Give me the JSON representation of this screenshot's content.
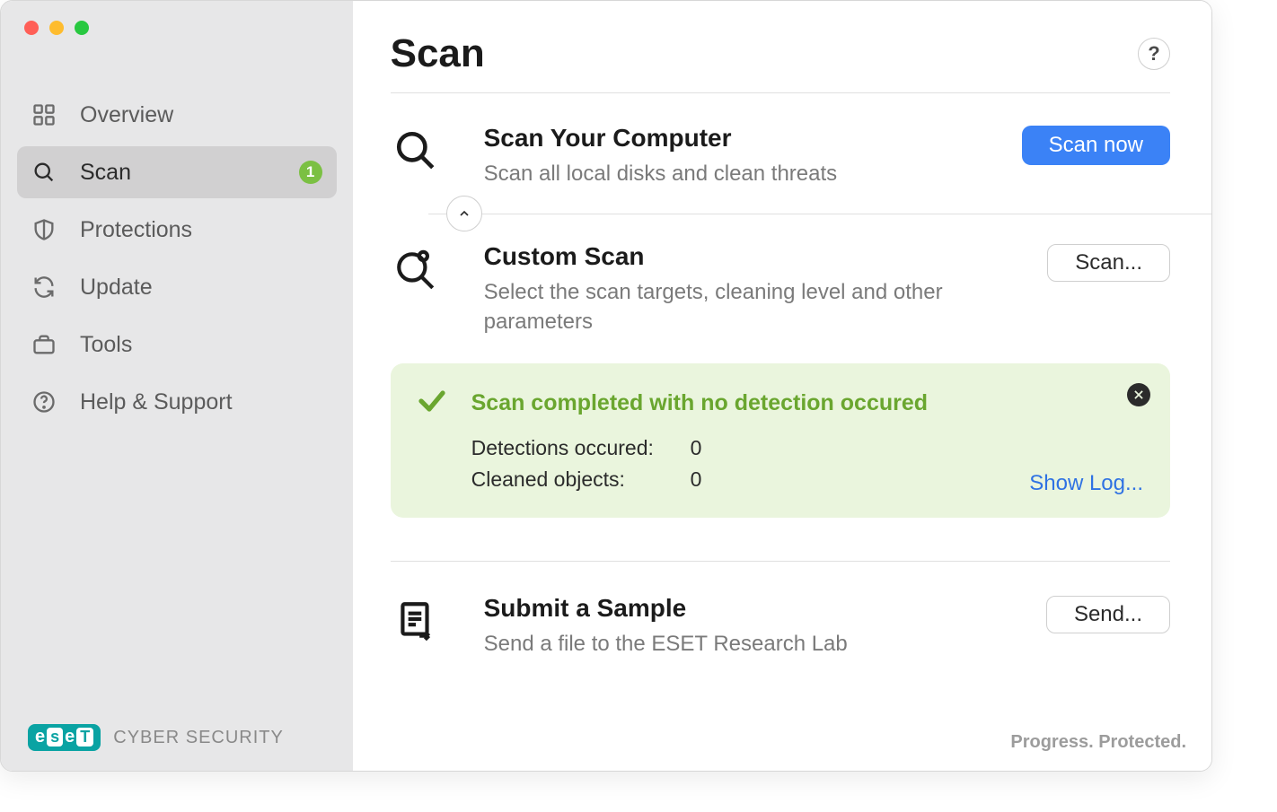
{
  "sidebar": {
    "items": [
      {
        "label": "Overview"
      },
      {
        "label": "Scan",
        "badge": "1"
      },
      {
        "label": "Protections"
      },
      {
        "label": "Update"
      },
      {
        "label": "Tools"
      },
      {
        "label": "Help & Support"
      }
    ],
    "brand_sub": "CYBER SECURITY"
  },
  "header": {
    "title": "Scan",
    "help": "?"
  },
  "scan_computer": {
    "title": "Scan Your Computer",
    "desc": "Scan all local disks and clean threats",
    "action": "Scan now"
  },
  "custom_scan": {
    "title": "Custom Scan",
    "desc": "Select the scan targets, cleaning level and other parameters",
    "action": "Scan..."
  },
  "result": {
    "title": "Scan completed with no detection occured",
    "detections_label": "Detections occured:",
    "detections_value": "0",
    "cleaned_label": "Cleaned objects:",
    "cleaned_value": "0",
    "show_log": "Show Log..."
  },
  "submit": {
    "title": "Submit a Sample",
    "desc": "Send a file to the ESET Research Lab",
    "action": "Send..."
  },
  "footer": {
    "tagline": "Progress. Protected."
  }
}
